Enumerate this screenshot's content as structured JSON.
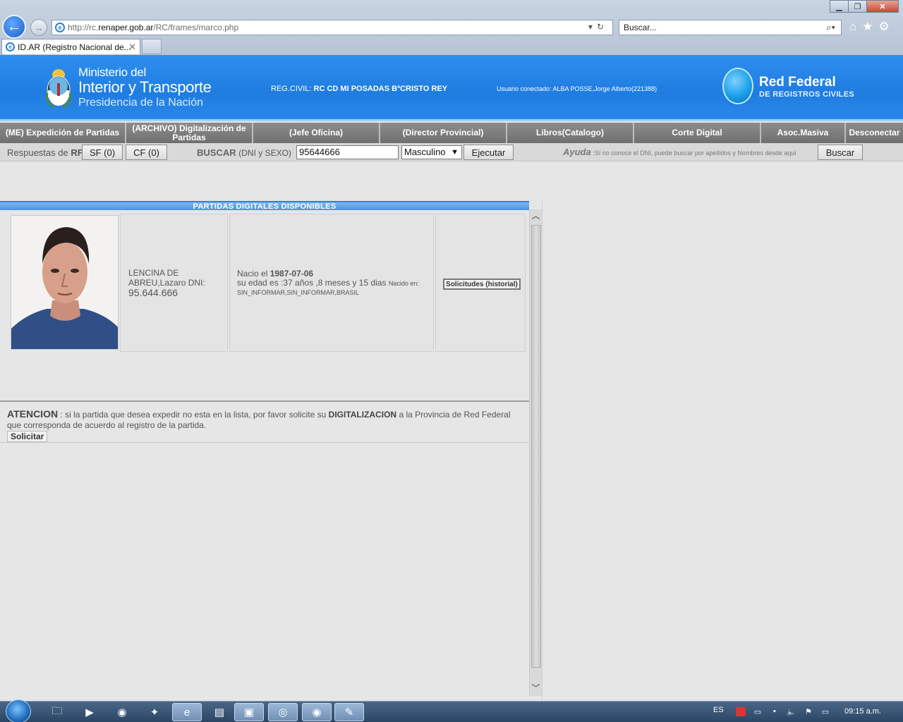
{
  "browser": {
    "url_prefix": "http://rc.",
    "url_host": "renaper.gob.ar",
    "url_path": "/RC/frames/marco.php",
    "search_placeholder": "Buscar...",
    "tab_title": "ID.AR (Registro Nacional de..."
  },
  "header": {
    "ministry_line1": "Ministerio del",
    "ministry_line2": "Interior y Transporte",
    "ministry_line3": "Presidencia de la Nación",
    "regcivil_label": "REG.CIVIL:",
    "regcivil_value": "RC CD MI POSADAS BºCRISTO REY",
    "usuario": "Usuario conectado: ALBA POSSE,Jorge Alberto(221388)",
    "redfederal_title": "Red Federal",
    "redfederal_sub": "DE REGISTROS CIVILES"
  },
  "menu": [
    "(ME) Expedición de Partidas",
    "(ARCHIVO) Digitalización de Partidas",
    "(Jefe Oficina)",
    "(Director Provincial)",
    "Libros(Catalogo)",
    "Corte Digital",
    "Asoc.Masiva",
    "Desconectar"
  ],
  "search": {
    "respuestas_label": "Respuestas de",
    "respuestas_rf": "RF",
    "sf_button": "SF (0)",
    "cf_button": "CF (0)",
    "buscar_label": "BUSCAR",
    "buscar_hint": "(DNI y SEXO)",
    "dni_value": "95644666",
    "sex_value": "Masculino",
    "ejecutar_button": "Ejecutar",
    "ayuda_label": "Ayuda",
    "ayuda_text": ":Sí no conoce el DNI, puede buscar por apellidos y Nombres desde aquí",
    "buscar_button": "Buscar"
  },
  "results": {
    "header": "PARTIDAS DIGITALES DISPONIBLES",
    "person_name": "LENCINA DE ABREU,Lazaro DNI:",
    "person_dni": "95.644.666",
    "nacio_label": "Nacio el",
    "nacio_date": "1987-07-06",
    "edad_text": "su edad es :37 años ,8 meses y 15 dias",
    "nacido_en_label": "Nacido en:",
    "nacido_en_value": "SIN_INFORMAR,SIN_INFORMAR,BRASIL",
    "history_button": "Solicitudes (historial)"
  },
  "atencion": {
    "title": "ATENCION",
    "text1": ": si la partida que desea expedir no esta en la lista, por favor solicite su",
    "text_bold": "DIGITALIZACION",
    "text2": "a la Provincia de Red Federal que corresponda de acuerdo al registro de la partida.",
    "button": "Solicitar"
  },
  "taskbar": {
    "language": "ES",
    "clock": "09:15 a.m."
  }
}
